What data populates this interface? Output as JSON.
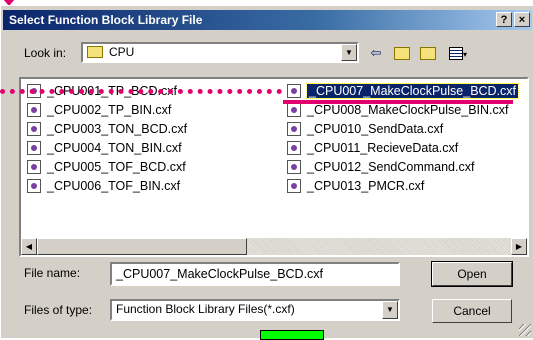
{
  "window": {
    "title": "Select Function Block Library File",
    "help_label": "?",
    "close_label": "×"
  },
  "lookin": {
    "label": "Look in:",
    "value": "CPU"
  },
  "toolbar": {
    "icons": [
      "back-arrow-icon",
      "up-folder-icon",
      "new-folder-icon",
      "view-menu-icon"
    ]
  },
  "files": {
    "col1": [
      "_CPU001_TP_BCD.cxf",
      "_CPU002_TP_BIN.cxf",
      "_CPU003_TON_BCD.cxf",
      "_CPU004_TON_BIN.cxf",
      "_CPU005_TOF_BCD.cxf",
      "_CPU006_TOF_BIN.cxf"
    ],
    "col2": [
      "_CPU007_MakeClockPulse_BCD.cxf",
      "_CPU008_MakeClockPulse_BIN.cxf",
      "_CPU010_SendData.cxf",
      "_CPU011_RecieveData.cxf",
      "_CPU012_SendCommand.cxf",
      "_CPU013_PMCR.cxf"
    ],
    "selected": "_CPU007_MakeClockPulse_BCD.cxf"
  },
  "filename": {
    "label": "File name:",
    "value": "_CPU007_MakeClockPulse_BCD.cxf"
  },
  "filetype": {
    "label": "Files of type:",
    "value": "Function Block Library Files(*.cxf)"
  },
  "buttons": {
    "open": "Open",
    "cancel": "Cancel"
  },
  "colors": {
    "annotation": "#e3006e",
    "titlebar": "#0a246a",
    "highlight": "#00ff00"
  }
}
